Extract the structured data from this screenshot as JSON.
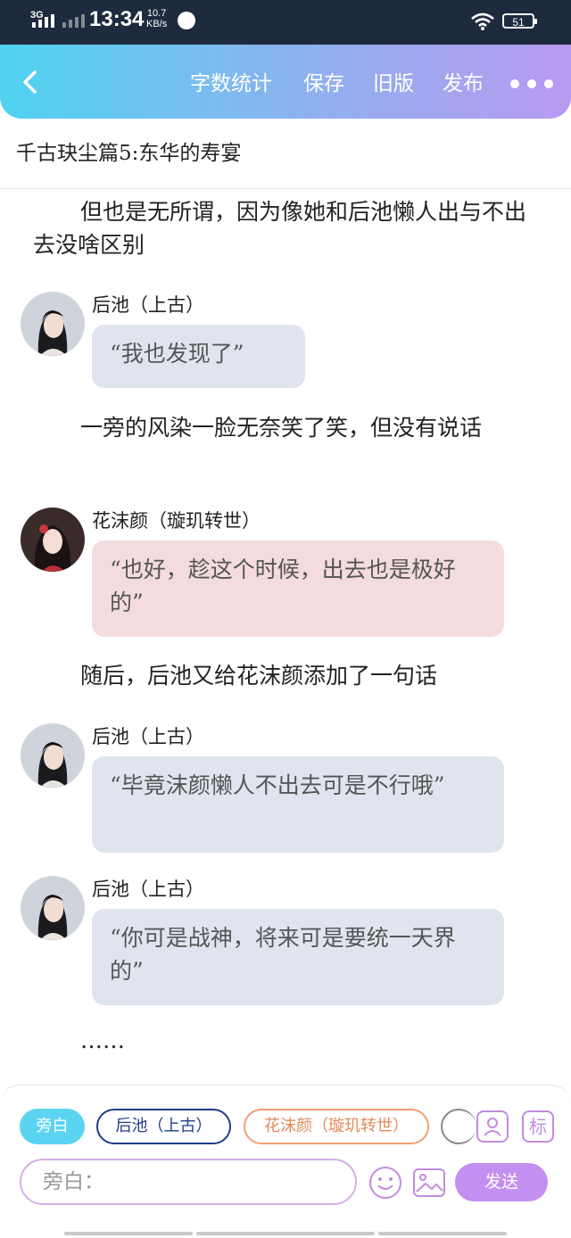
{
  "status": {
    "network": "3G",
    "time": "13:34",
    "speed_value": "10.7",
    "speed_unit": "KB/s",
    "battery": "51"
  },
  "toolbar": {
    "word_count": "字数统计",
    "save": "保存",
    "old_version": "旧版",
    "publish": "发布"
  },
  "title": "千古玦尘篇5:东华的寿宴",
  "messages": [
    {
      "type": "narration",
      "text": "但也是无所谓，因为像她和后池懒人出与不出去没啥区别"
    },
    {
      "type": "speech",
      "speaker": "后池（上古）",
      "text": "“我也发现了”",
      "color": "#dfe4ee"
    },
    {
      "type": "narration",
      "text": "一旁的风染一脸无奈笑了笑，但没有说话"
    },
    {
      "type": "speech",
      "speaker": "花沫颜（璇玑转世）",
      "text": "“也好，趁这个时候，出去也是极好的”",
      "color": "#f3dbde"
    },
    {
      "type": "narration",
      "text": "随后，后池又给花沫颜添加了一句话"
    },
    {
      "type": "speech",
      "speaker": "后池（上古）",
      "text": "“毕竟沫颜懒人不出去可是不行哦”",
      "color": "#dfe4ee"
    },
    {
      "type": "speech",
      "speaker": "后池（上古）",
      "text": "“你可是战神，将来可是要统一天界的”",
      "color": "#dfe4ee"
    },
    {
      "type": "narration",
      "text": "……"
    }
  ],
  "composer": {
    "chips": [
      "旁白",
      "后池（上古）",
      "花沫颜（璇玑转世）"
    ],
    "mark_label": "标",
    "placeholder": "旁白：",
    "send": "发送"
  },
  "colors": {
    "accent": "#c38ff0",
    "narration_chip": "#5bd4f2",
    "header_start": "#4fd3f0",
    "header_end": "#b89af0"
  }
}
